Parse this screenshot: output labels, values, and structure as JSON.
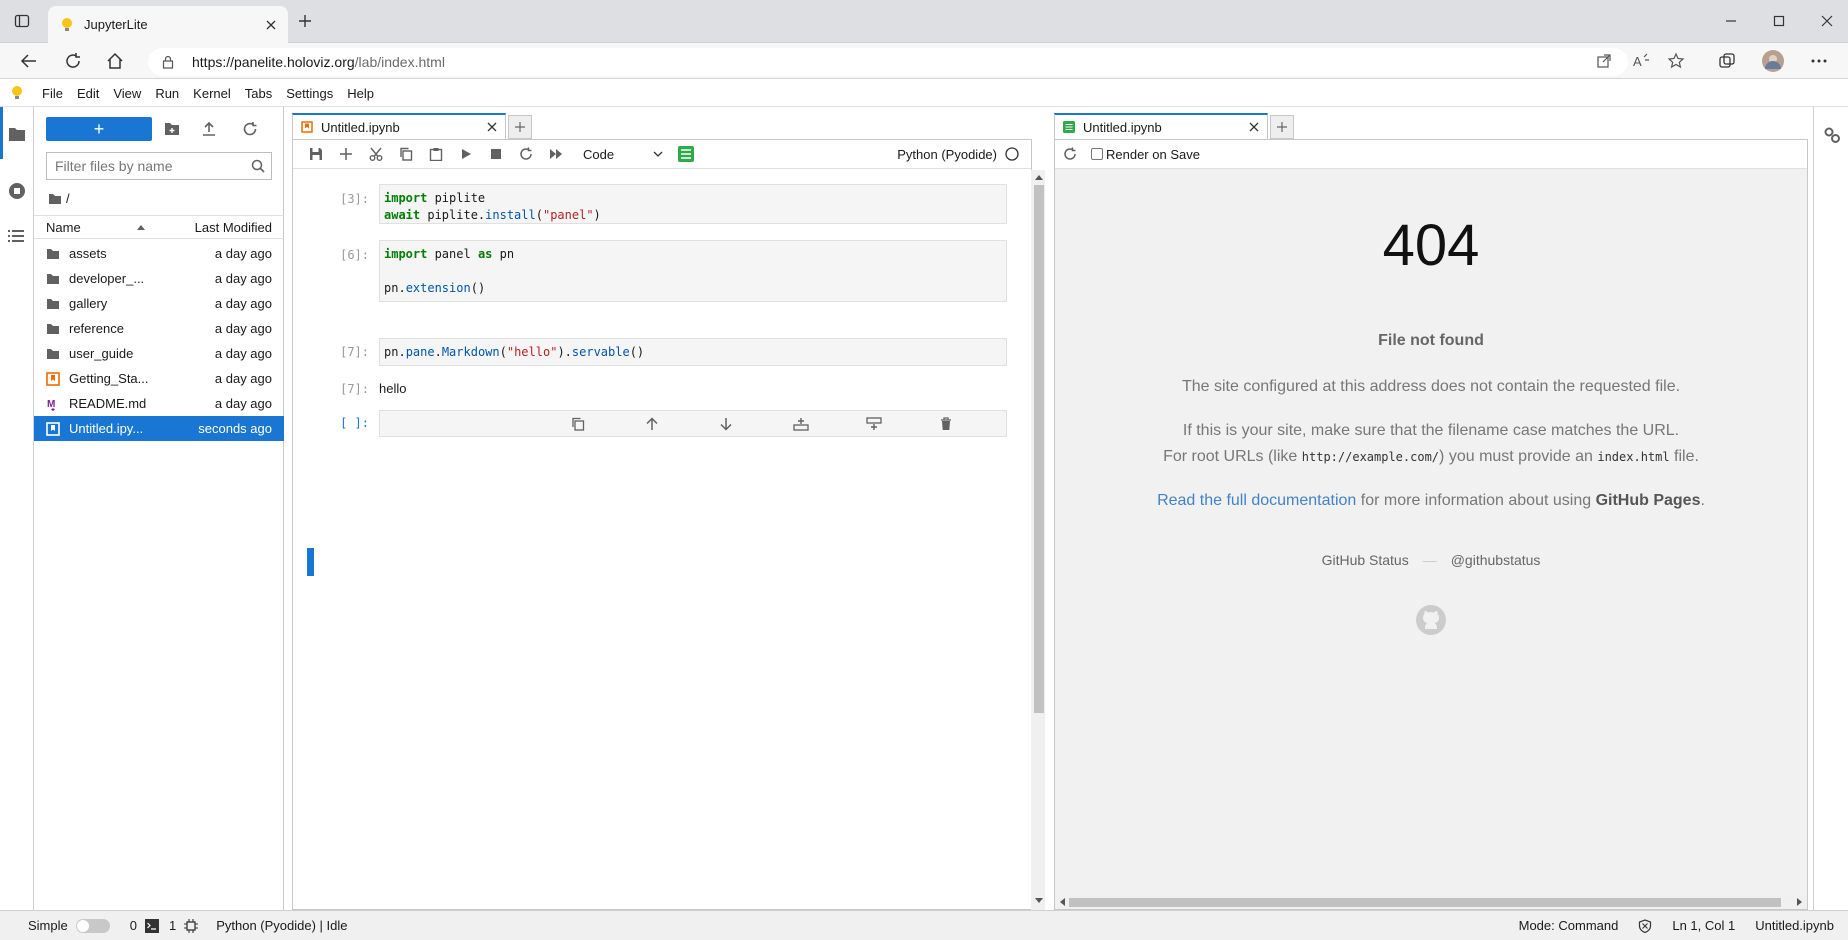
{
  "browser": {
    "tab_title": "JupyterLite",
    "url_host": "https://panelite.holoviz.org",
    "url_rest": "/lab/index.html"
  },
  "menubar": {
    "items": [
      "File",
      "Edit",
      "View",
      "Run",
      "Kernel",
      "Tabs",
      "Settings",
      "Help"
    ]
  },
  "filebrowser": {
    "new_label": "+",
    "filter_placeholder": "Filter files by name",
    "breadcrumb": "/",
    "col_name": "Name",
    "col_modified": "Last Modified",
    "files": [
      {
        "name": "assets",
        "modified": "a day ago",
        "icon": "folder-icon"
      },
      {
        "name": "developer_...",
        "modified": "a day ago",
        "icon": "folder-icon"
      },
      {
        "name": "gallery",
        "modified": "a day ago",
        "icon": "folder-icon"
      },
      {
        "name": "reference",
        "modified": "a day ago",
        "icon": "folder-icon"
      },
      {
        "name": "user_guide",
        "modified": "a day ago",
        "icon": "folder-icon"
      },
      {
        "name": "Getting_Sta...",
        "modified": "a day ago",
        "icon": "notebook-icon"
      },
      {
        "name": "README.md",
        "modified": "a day ago",
        "icon": "markdown-icon"
      },
      {
        "name": "Untitled.ipy...",
        "modified": "seconds ago",
        "icon": "notebook-icon"
      }
    ]
  },
  "notebook": {
    "tab_title": "Untitled.ipynb",
    "cell_type": "Code",
    "kernel": "Python (Pyodide)",
    "cells": [
      {
        "prompt": "[3]:"
      },
      {
        "prompt": "[6]:"
      },
      {
        "prompt": "[7]:"
      },
      {
        "prompt": "[7]:",
        "output": "hello"
      },
      {
        "prompt": "[ ]:"
      }
    ],
    "code": {
      "c1_kw1": "import",
      "c1_t1": " piplite",
      "c1_kw2": "await",
      "c1_t2": " piplite.",
      "c1_fn": "install",
      "c1_t3": "(",
      "c1_str": "\"panel\"",
      "c1_t4": ")",
      "c2_kw1": "import",
      "c2_t1": " panel ",
      "c2_kw2": "as",
      "c2_t2": " pn",
      "c2_t3": "pn.",
      "c2_fn": "extension",
      "c2_t4": "()",
      "c3_t1": "pn.",
      "c3_fn1": "pane",
      "c3_t2": ".",
      "c3_fn2": "Markdown",
      "c3_t3": "(",
      "c3_str": "\"hello\"",
      "c3_t4": ").",
      "c3_fn3": "servable",
      "c3_t5": "()"
    }
  },
  "preview": {
    "tab_title": "Untitled.ipynb",
    "render_on_save": "Render on Save",
    "code": "404",
    "heading": "File not found",
    "line1": "The site configured at this address does not contain the requested file.",
    "line2": "If this is your site, make sure that the filename case matches the URL.",
    "line3_a": "For root URLs (like ",
    "line3_code1": "http://example.com/",
    "line3_b": ") you must provide an ",
    "line3_code2": "index.html",
    "line3_c": " file.",
    "line4_link": "Read the full documentation",
    "line4_b": " for more information about using ",
    "line4_bold": "GitHub Pages",
    "line4_c": ".",
    "status_link": "GitHub Status",
    "separator": "—",
    "twitter": "@githubstatus"
  },
  "statusbar": {
    "mode_label": "Simple",
    "count1": "0",
    "count2": "1",
    "kernel_status": "Python (Pyodide) | Idle",
    "mode": "Mode: Command",
    "position": "Ln 1, Col 1",
    "file": "Untitled.ipynb"
  },
  "colors": {
    "accent": "#1976d2",
    "link": "#4183c4"
  }
}
